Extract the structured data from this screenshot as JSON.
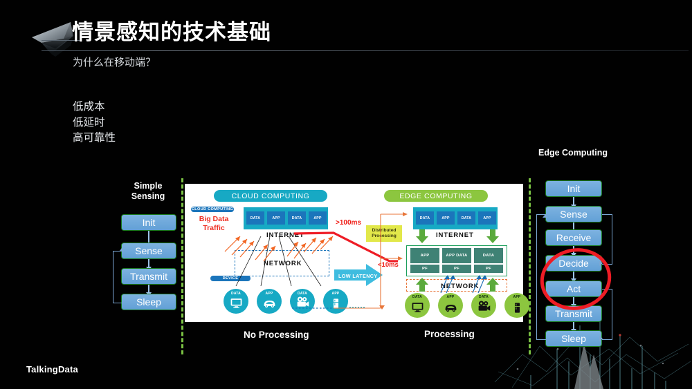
{
  "slide": {
    "background_color": "#010101",
    "title": "情景感知的技术基础",
    "subtitle": "为什么在移动端？",
    "bullets": [
      "低成本",
      "低延时",
      "高可靠性"
    ],
    "footer_logo": "TalkingData"
  },
  "left_flow": {
    "title_line1": "Simple",
    "title_line2": "Sensing",
    "nodes": [
      {
        "label": "Init"
      },
      {
        "label": "Sense"
      },
      {
        "label": "Transmit"
      },
      {
        "label": "Sleep"
      }
    ]
  },
  "right_flow": {
    "title": "Edge Computing",
    "nodes": [
      {
        "label": "Init"
      },
      {
        "label": "Sense"
      },
      {
        "label": "Receive"
      },
      {
        "label": "Decide"
      },
      {
        "label": "Act"
      },
      {
        "label": "Transmit"
      },
      {
        "label": "Sleep"
      }
    ],
    "highlight_color": "#ee1c25",
    "highlighted_nodes": [
      "Decide",
      "Act"
    ]
  },
  "diagram": {
    "cloud": {
      "header": "CLOUD COMPUTING",
      "tag": "CLOUD COMPUTING",
      "big_data_line1": "Big Data",
      "big_data_line2": "Traffic",
      "cells": [
        "DATA",
        "APP",
        "DATA",
        "APP"
      ],
      "internet": "INTERNET",
      "network": "NETWORK",
      "device_tag": "DEVICE",
      "devices": [
        {
          "label": "DATA",
          "icon": "monitor-icon"
        },
        {
          "label": "APP",
          "icon": "car-icon"
        },
        {
          "label": "DATA",
          "icon": "video-camera-icon"
        },
        {
          "label": "APP",
          "icon": "refrigerator-icon"
        }
      ],
      "caption": "No Processing",
      "color": "#17a9c4"
    },
    "edge": {
      "header": "EDGE COMPUTING",
      "cells": [
        "DATA",
        "APP",
        "DATA",
        "APP"
      ],
      "internet": "INTERNET",
      "servers": [
        {
          "top": "APP",
          "bottom": "PF"
        },
        {
          "top": "APP DATA",
          "bottom": "PF"
        },
        {
          "top": "DATA",
          "bottom": "PF"
        }
      ],
      "network": "NETWORK",
      "devices": [
        {
          "label": "DATA",
          "icon": "monitor-icon"
        },
        {
          "label": "APP",
          "icon": "car-icon"
        },
        {
          "label": "DATA",
          "icon": "video-camera-icon"
        },
        {
          "label": "APP",
          "icon": "refrigerator-icon"
        }
      ],
      "caption": "Processing",
      "color": "#8cc63f"
    },
    "middle": {
      "high_latency": ">100ms",
      "low_latency_ms": "<10ms",
      "low_latency_arrow": "LOW LATENCY",
      "distributed_line1": "Distributed",
      "distributed_line2": "Processing"
    }
  }
}
